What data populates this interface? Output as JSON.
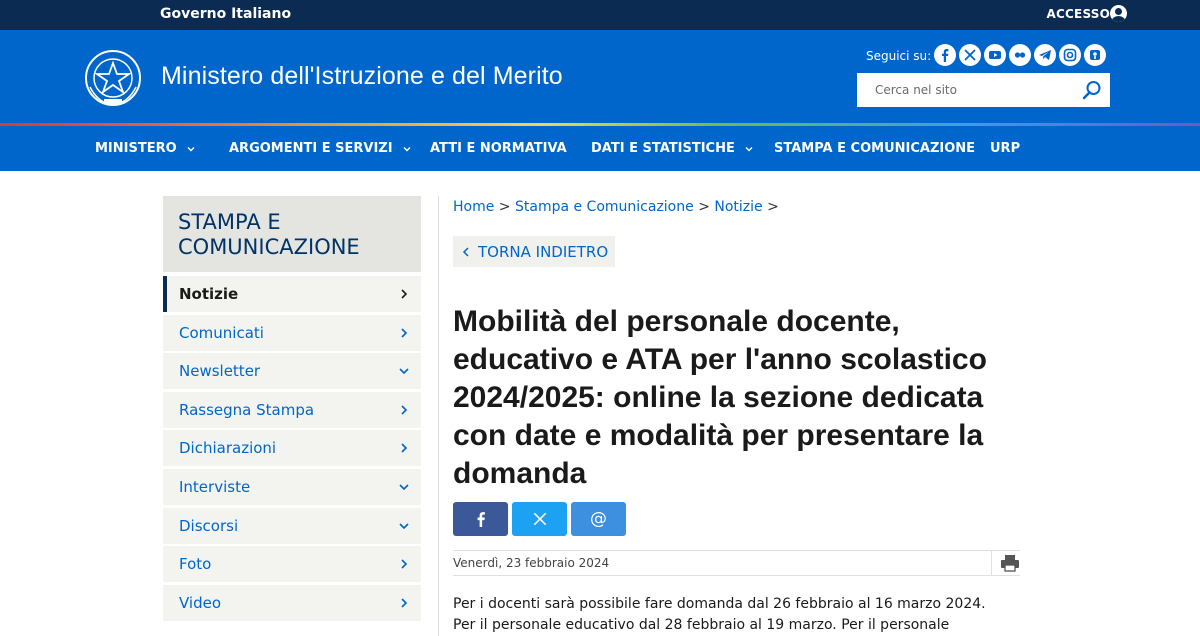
{
  "topbar": {
    "gov_label": "Governo Italiano",
    "access_label": "ACCESSO"
  },
  "header": {
    "title": "Ministero dell'Istruzione e del Merito",
    "follow_label": "Seguici su:",
    "socials": [
      "facebook-icon",
      "x-icon",
      "youtube-icon",
      "flickr-icon",
      "telegram-icon",
      "instagram-icon",
      "podcast-icon"
    ],
    "search_placeholder": "Cerca nel sito"
  },
  "nav": {
    "items": [
      {
        "label": "MINISTERO",
        "dropdown": true
      },
      {
        "label": "ARGOMENTI E SERVIZI",
        "dropdown": true
      },
      {
        "label": "ATTI E NORMATIVA",
        "dropdown": false
      },
      {
        "label": "DATI E STATISTICHE",
        "dropdown": true
      },
      {
        "label": "STAMPA E COMUNICAZIONE",
        "dropdown": false
      },
      {
        "label": "URP",
        "dropdown": false
      }
    ]
  },
  "sidebar": {
    "title": "STAMPA E COMUNICAZIONE",
    "items": [
      {
        "label": "Notizie",
        "arrow": "right",
        "active": true
      },
      {
        "label": "Comunicati",
        "arrow": "right"
      },
      {
        "label": "Newsletter",
        "arrow": "down"
      },
      {
        "label": "Rassegna Stampa",
        "arrow": "right"
      },
      {
        "label": "Dichiarazioni",
        "arrow": "right"
      },
      {
        "label": "Interviste",
        "arrow": "down"
      },
      {
        "label": "Discorsi",
        "arrow": "down"
      },
      {
        "label": "Foto",
        "arrow": "right"
      },
      {
        "label": "Video",
        "arrow": "right"
      }
    ]
  },
  "breadcrumb": {
    "home": "Home",
    "section": "Stampa e Comunicazione",
    "page": "Notizie",
    "separator": ">"
  },
  "back_label": "TORNA INDIETRO",
  "article": {
    "title": "Mobilità del personale docente, educativo e ATA per l'anno scolastico 2024/2025: online la sezione dedicata con date e modalità per presentare la domanda",
    "date": "Venerdì, 23 febbraio 2024",
    "body_line1": "Per i docenti sarà possibile fare domanda dal 26 febbraio al 16 marzo 2024.",
    "body_line2": "Per il personale educativo dal 28 febbraio al 19 marzo. Per il personale"
  },
  "share": {
    "buttons": [
      {
        "name": "facebook",
        "color": "#3b5998"
      },
      {
        "name": "x",
        "color": "#1da1f2"
      },
      {
        "name": "email",
        "color": "#3d8fe0"
      }
    ],
    "email_glyph": "@"
  },
  "colors": {
    "primary": "#0066cc",
    "topbar": "#0b2b52",
    "sidebar_bg": "#f3f3ef"
  }
}
